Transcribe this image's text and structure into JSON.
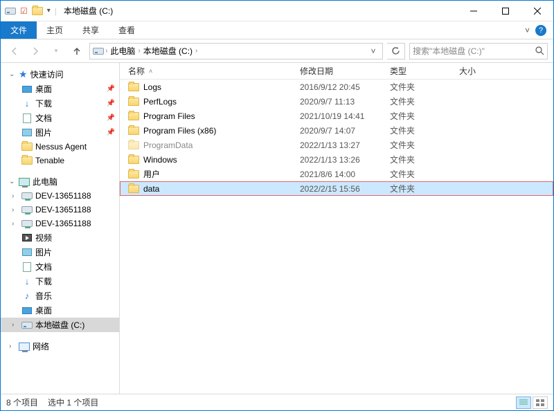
{
  "window": {
    "title": "本地磁盘 (C:)",
    "qat_divider": "|"
  },
  "ribbon": {
    "file": "文件",
    "tabs": [
      "主页",
      "共享",
      "查看"
    ]
  },
  "address": {
    "crumbs": [
      "此电脑",
      "本地磁盘 (C:)"
    ],
    "search_placeholder": "搜索\"本地磁盘 (C:)\""
  },
  "nav": {
    "quick": {
      "label": "快速访问",
      "items": [
        {
          "label": "桌面",
          "pinned": true,
          "icon": "desktop"
        },
        {
          "label": "下载",
          "pinned": true,
          "icon": "download"
        },
        {
          "label": "文档",
          "pinned": true,
          "icon": "document"
        },
        {
          "label": "图片",
          "pinned": true,
          "icon": "image"
        },
        {
          "label": "Nessus Agent",
          "pinned": false,
          "icon": "folder"
        },
        {
          "label": "Tenable",
          "pinned": false,
          "icon": "folder"
        }
      ]
    },
    "pc": {
      "label": "此电脑",
      "items": [
        {
          "label": "DEV-13651188",
          "icon": "netdisk"
        },
        {
          "label": "DEV-13651188",
          "icon": "netdisk"
        },
        {
          "label": "DEV-13651188",
          "icon": "netdisk"
        },
        {
          "label": "视频",
          "icon": "video"
        },
        {
          "label": "图片",
          "icon": "image"
        },
        {
          "label": "文档",
          "icon": "document"
        },
        {
          "label": "下载",
          "icon": "download"
        },
        {
          "label": "音乐",
          "icon": "music"
        },
        {
          "label": "桌面",
          "icon": "desktop"
        },
        {
          "label": "本地磁盘 (C:)",
          "icon": "disk",
          "selected": true
        }
      ]
    },
    "network": {
      "label": "网络"
    }
  },
  "columns": {
    "name": "名称",
    "date": "修改日期",
    "type": "类型",
    "size": "大小"
  },
  "files": [
    {
      "name": "Logs",
      "date": "2016/9/12 20:45",
      "type": "文件夹",
      "hidden": false
    },
    {
      "name": "PerfLogs",
      "date": "2020/9/7 11:13",
      "type": "文件夹",
      "hidden": false
    },
    {
      "name": "Program Files",
      "date": "2021/10/19 14:41",
      "type": "文件夹",
      "hidden": false
    },
    {
      "name": "Program Files (x86)",
      "date": "2020/9/7 14:07",
      "type": "文件夹",
      "hidden": false
    },
    {
      "name": "ProgramData",
      "date": "2022/1/13 13:27",
      "type": "文件夹",
      "hidden": true
    },
    {
      "name": "Windows",
      "date": "2022/1/13 13:26",
      "type": "文件夹",
      "hidden": false
    },
    {
      "name": "用户",
      "date": "2021/8/6 14:00",
      "type": "文件夹",
      "hidden": false
    },
    {
      "name": "data",
      "date": "2022/2/15 15:56",
      "type": "文件夹",
      "hidden": false,
      "selected": true
    }
  ],
  "status": {
    "count": "8 个项目",
    "selection": "选中 1 个项目"
  }
}
